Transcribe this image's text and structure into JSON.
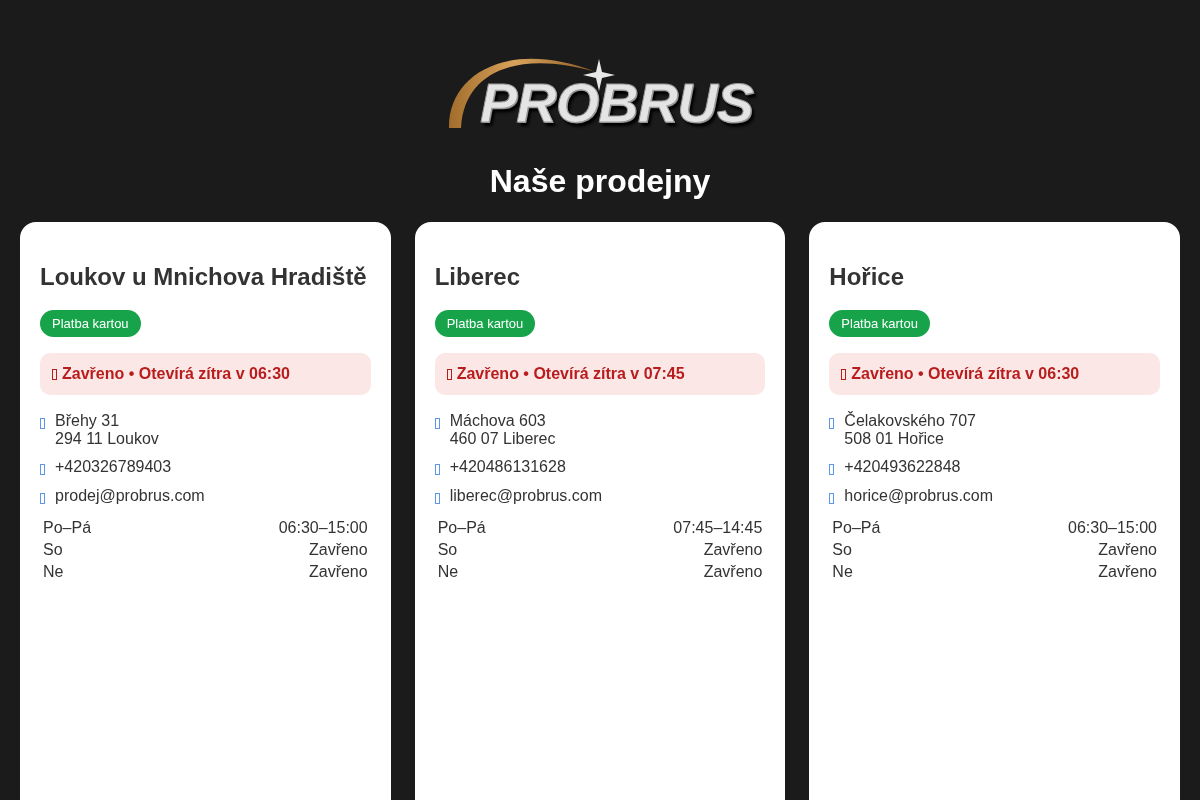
{
  "logo": {
    "text": "PROBRUS"
  },
  "heading": "Naše prodejny",
  "stores": [
    {
      "name": "Loukov u Mnichova Hradiště",
      "badges": [
        "Platba kartou"
      ],
      "status": {
        "open": false,
        "text": "Zavřeno • Otevírá zítra v 06:30"
      },
      "address": [
        "Břehy 31",
        "294 11 Loukov"
      ],
      "phone": "+420326789403",
      "email": "prodej@probrus.com",
      "hours": [
        {
          "days": "Po–Pá",
          "time": "06:30–15:00"
        },
        {
          "days": "So",
          "time": "Zavřeno"
        },
        {
          "days": "Ne",
          "time": "Zavřeno"
        }
      ]
    },
    {
      "name": "Liberec",
      "badges": [
        "Platba kartou"
      ],
      "status": {
        "open": false,
        "text": "Zavřeno • Otevírá zítra v 07:45"
      },
      "address": [
        "Máchova 603",
        "460 07 Liberec"
      ],
      "phone": "+420486131628",
      "email": "liberec@probrus.com",
      "hours": [
        {
          "days": "Po–Pá",
          "time": "07:45–14:45"
        },
        {
          "days": "So",
          "time": "Zavřeno"
        },
        {
          "days": "Ne",
          "time": "Zavřeno"
        }
      ]
    },
    {
      "name": "Hořice",
      "badges": [
        "Platba kartou"
      ],
      "status": {
        "open": false,
        "text": "Zavřeno • Otevírá zítra v 06:30"
      },
      "address": [
        "Čelakovského 707",
        "508 01 Hořice"
      ],
      "phone": "+420493622848",
      "email": "horice@probrus.com",
      "hours": [
        {
          "days": "Po–Pá",
          "time": "06:30–15:00"
        },
        {
          "days": "So",
          "time": "Zavřeno"
        },
        {
          "days": "Ne",
          "time": "Zavřeno"
        }
      ]
    }
  ]
}
